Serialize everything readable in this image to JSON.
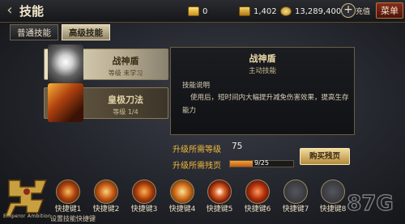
{
  "header": {
    "title": "技能",
    "resources": [
      {
        "icon": "gold-ingot-icon",
        "value": "0"
      },
      {
        "icon": "gold-bar-icon",
        "value": "1,402"
      },
      {
        "icon": "coin-icon",
        "value": "13,289,400"
      }
    ],
    "recharge_label": "充值",
    "menu_label": "菜单"
  },
  "tabs": [
    {
      "label": "普通技能",
      "active": false
    },
    {
      "label": "高级技能",
      "active": true
    }
  ],
  "skills": [
    {
      "name": "战神盾",
      "level": "等级 未学习",
      "icon": "warrior-shield-icon",
      "selected": true
    },
    {
      "name": "皇极刀法",
      "level": "等级 1/4",
      "icon": "blade-technique-icon",
      "selected": false
    }
  ],
  "detail": {
    "name": "战神盾",
    "type": "主动技能",
    "desc_title": "技能说明",
    "desc_text": "使用后，短时间内大幅提升减免伤害效果，提高生存能力"
  },
  "upgrade": {
    "level_label": "升级所需等级",
    "level_value": "75",
    "fragment_label": "升级所需残页",
    "fragment_text": "9/25",
    "fragment_progress": 0.36,
    "buy_label": "购买残页"
  },
  "shortcuts": [
    {
      "label": "快捷键1",
      "icon": "skill-slash-icon"
    },
    {
      "label": "快捷键2",
      "icon": "skill-spin-icon"
    },
    {
      "label": "快捷键3",
      "icon": "skill-fire-icon"
    },
    {
      "label": "快捷键4",
      "icon": "skill-flame-icon"
    },
    {
      "label": "快捷键5",
      "icon": "skill-burst-icon"
    },
    {
      "label": "快捷键6",
      "icon": "skill-blades-icon"
    },
    {
      "label": "快捷键7",
      "icon": "skill-empty-icon"
    },
    {
      "label": "快捷键8",
      "icon": "skill-empty-icon"
    }
  ],
  "shortcut_tip": "设置技能快捷键",
  "logo": {
    "text": "Emperor Ambition"
  },
  "watermark": "87G",
  "colors": {
    "accent": "#f2ba3c",
    "menu": "#8a2b1d",
    "progress": "#e47f22"
  }
}
